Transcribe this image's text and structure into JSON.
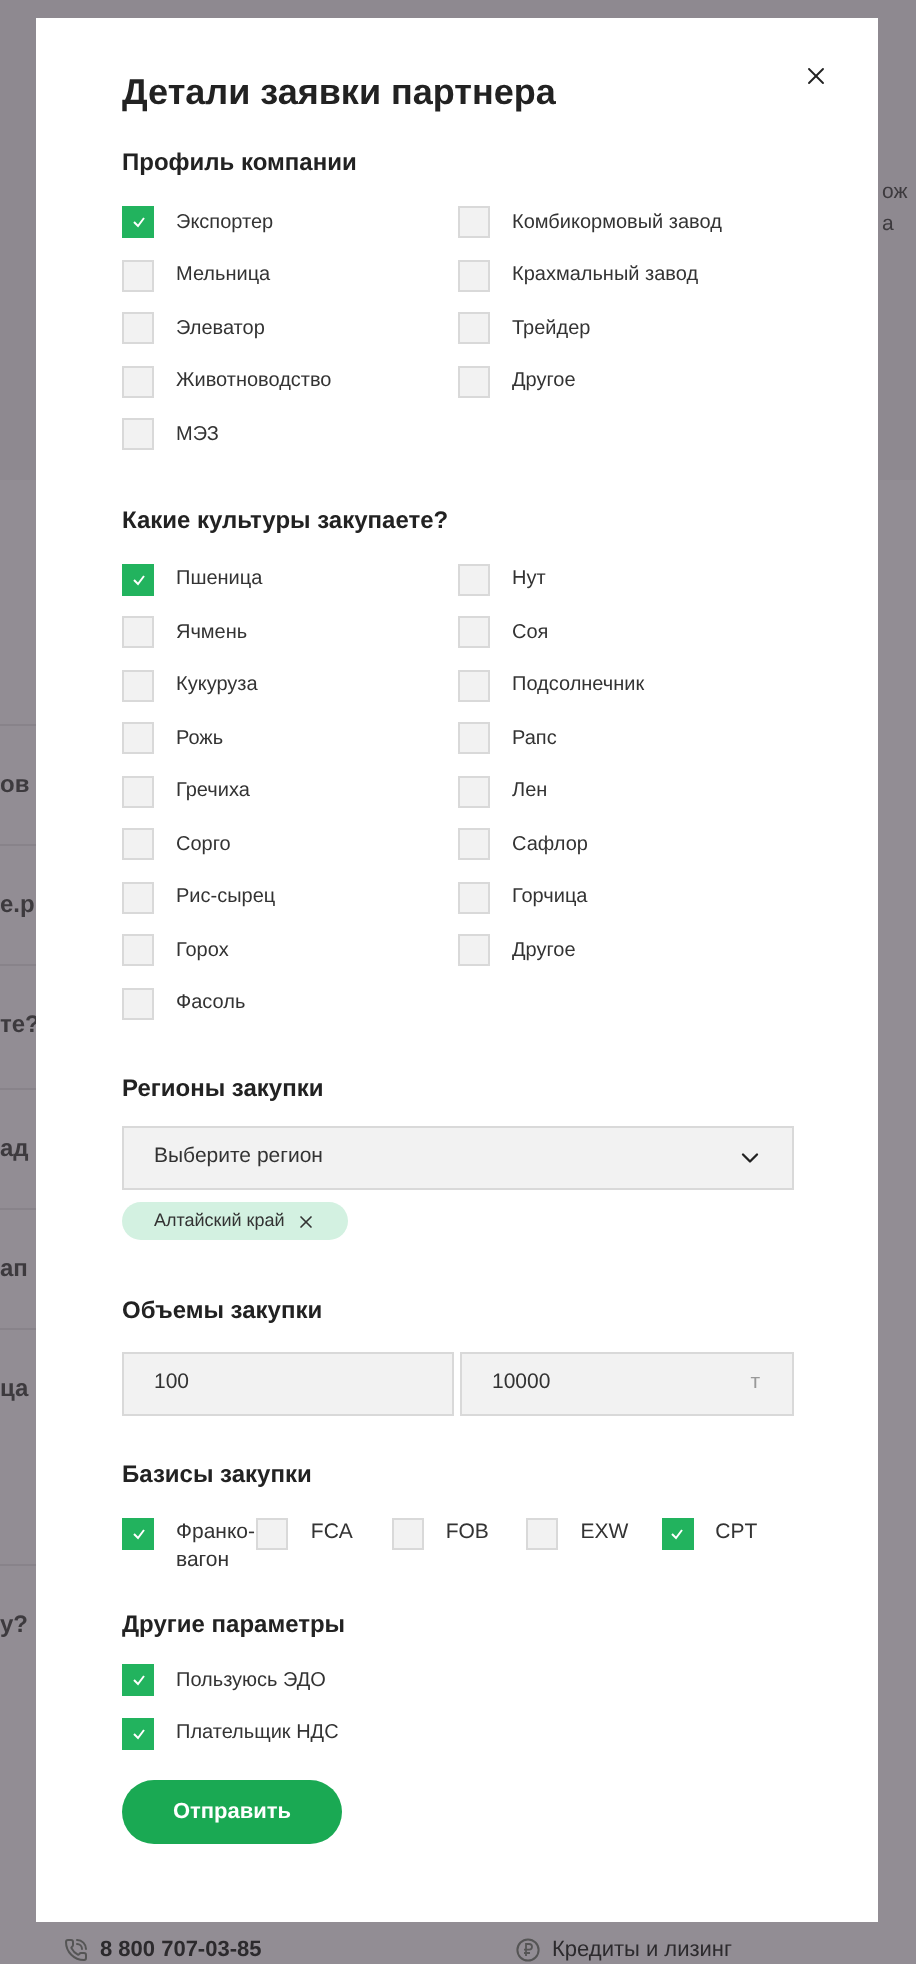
{
  "background": {
    "right_fragments": [
      "ож",
      "а"
    ],
    "left_fragments": [
      "ов",
      "е.р",
      "те?",
      "ад",
      "ап",
      "ца",
      "у?"
    ],
    "footer": {
      "phone": "8 800 707-03-85",
      "link": "Кредиты и лизинг"
    }
  },
  "dialog": {
    "title": "Детали заявки партнера",
    "profile": {
      "heading": "Профиль компании",
      "columns": [
        [
          {
            "label": "Экспортер",
            "checked": true
          },
          {
            "label": "Мельница",
            "checked": false
          },
          {
            "label": "Элеватор",
            "checked": false
          },
          {
            "label": "Животноводство",
            "checked": false
          },
          {
            "label": "МЭЗ",
            "checked": false
          }
        ],
        [
          {
            "label": "Комбикормовый завод",
            "checked": false
          },
          {
            "label": "Крахмальный завод",
            "checked": false
          },
          {
            "label": "Трейдер",
            "checked": false
          },
          {
            "label": "Другое",
            "checked": false
          }
        ]
      ]
    },
    "cultures": {
      "heading": "Какие культуры закупаете?",
      "columns": [
        [
          {
            "label": "Пшеница",
            "checked": true
          },
          {
            "label": "Ячмень",
            "checked": false
          },
          {
            "label": "Кукуруза",
            "checked": false
          },
          {
            "label": "Рожь",
            "checked": false
          },
          {
            "label": "Гречиха",
            "checked": false
          },
          {
            "label": "Сорго",
            "checked": false
          },
          {
            "label": "Рис-сырец",
            "checked": false
          },
          {
            "label": "Горох",
            "checked": false
          },
          {
            "label": "Фасоль",
            "checked": false
          }
        ],
        [
          {
            "label": "Нут",
            "checked": false
          },
          {
            "label": "Соя",
            "checked": false
          },
          {
            "label": "Подсолнечник",
            "checked": false
          },
          {
            "label": "Рапс",
            "checked": false
          },
          {
            "label": "Лен",
            "checked": false
          },
          {
            "label": "Сафлор",
            "checked": false
          },
          {
            "label": "Горчица",
            "checked": false
          },
          {
            "label": "Другое",
            "checked": false
          }
        ]
      ]
    },
    "regions": {
      "heading": "Регионы закупки",
      "select": {
        "placeholder": "Выберите регион"
      },
      "tags": [
        {
          "label": "Алтайский край"
        }
      ]
    },
    "volume": {
      "heading": "Объемы закупки",
      "from": {
        "value": "100"
      },
      "to": {
        "value": "10000",
        "unit": "т"
      }
    },
    "bases": {
      "heading": "Базисы закупки",
      "options": [
        {
          "label": "Франко-вагон",
          "checked": true
        },
        {
          "label": "FCA",
          "checked": false
        },
        {
          "label": "FOB",
          "checked": false
        },
        {
          "label": "EXW",
          "checked": false
        },
        {
          "label": "CPT",
          "checked": true
        }
      ]
    },
    "other": {
      "heading": "Другие параметры",
      "options": [
        {
          "label": "Пользуюсь ЭДО",
          "checked": true
        },
        {
          "label": "Плательщик НДС",
          "checked": true
        }
      ]
    },
    "submit": "Отправить"
  }
}
